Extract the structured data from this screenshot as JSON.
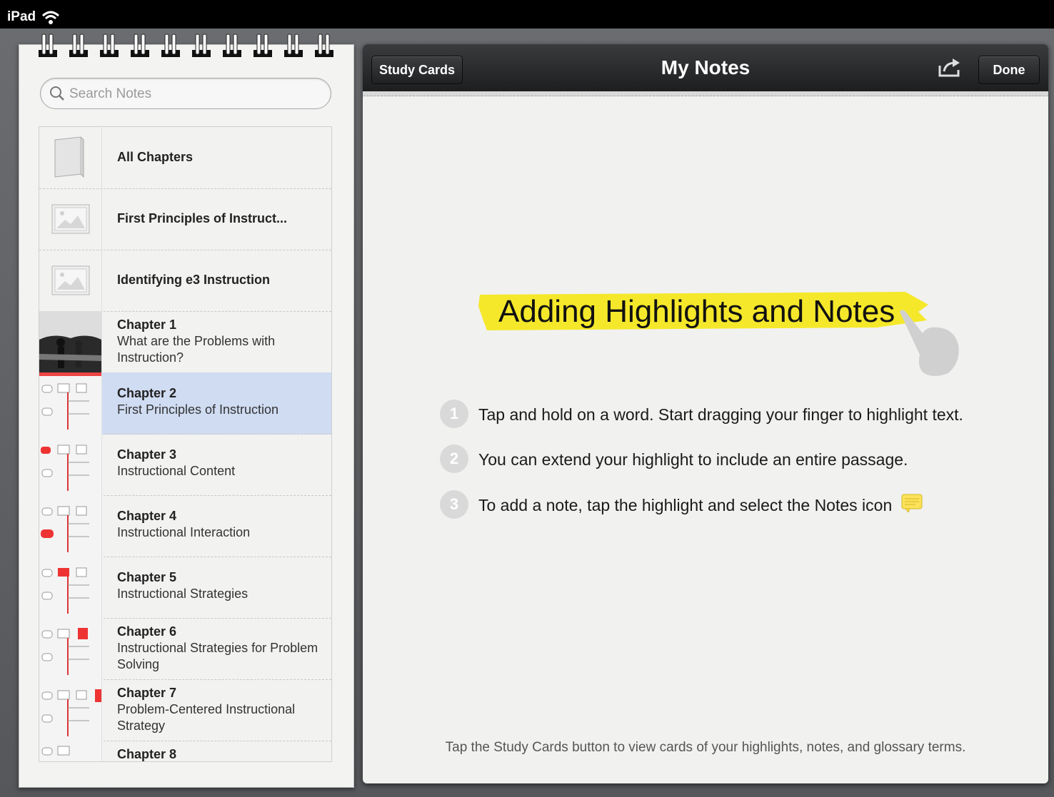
{
  "status_bar": {
    "device": "iPad"
  },
  "search": {
    "placeholder": "Search Notes"
  },
  "chapters": [
    {
      "title": "All Chapters",
      "subtitle": "",
      "thumb": "book-icon"
    },
    {
      "title": "First Principles of Instruct...",
      "subtitle": "",
      "thumb": "image-placeholder-icon"
    },
    {
      "title": "Identifying e3 Instruction",
      "subtitle": "",
      "thumb": "image-placeholder-icon"
    },
    {
      "title": "Chapter 1",
      "subtitle": "What are the Problems with Instruction?",
      "thumb": "photo-classroom"
    },
    {
      "title": "Chapter 2",
      "subtitle": "First Principles of Instruction",
      "thumb": "diagram-thumbnail",
      "selected": true
    },
    {
      "title": "Chapter 3",
      "subtitle": "Instructional Content",
      "thumb": "diagram-thumbnail"
    },
    {
      "title": "Chapter 4",
      "subtitle": "Instructional Interaction",
      "thumb": "diagram-thumbnail"
    },
    {
      "title": "Chapter 5",
      "subtitle": "Instructional Strategies",
      "thumb": "diagram-thumbnail"
    },
    {
      "title": "Chapter 6",
      "subtitle": "Instructional Strategies for Problem Solving",
      "thumb": "diagram-thumbnail"
    },
    {
      "title": "Chapter 7",
      "subtitle": "Problem-Centered Instructional Strategy",
      "thumb": "diagram-thumbnail"
    },
    {
      "title": "Chapter 8",
      "subtitle": "",
      "thumb": "diagram-thumbnail"
    }
  ],
  "navbar": {
    "study_cards_label": "Study Cards",
    "title": "My Notes",
    "done_label": "Done"
  },
  "help": {
    "headline": "Adding Highlights and Notes",
    "steps": [
      {
        "num": "1",
        "text": "Tap and hold on a word. Start dragging your finger to highlight text."
      },
      {
        "num": "2",
        "text": "You can extend your highlight to include an entire passage."
      },
      {
        "num": "3",
        "text": "To add a note, tap the highlight and select the Notes icon"
      }
    ],
    "footer": "Tap the Study Cards button to view cards of your highlights, notes, and glossary terms."
  },
  "colors": {
    "highlight": "#f5e82a",
    "selection": "#cfdcf2",
    "navbar": "#1d1e20"
  }
}
